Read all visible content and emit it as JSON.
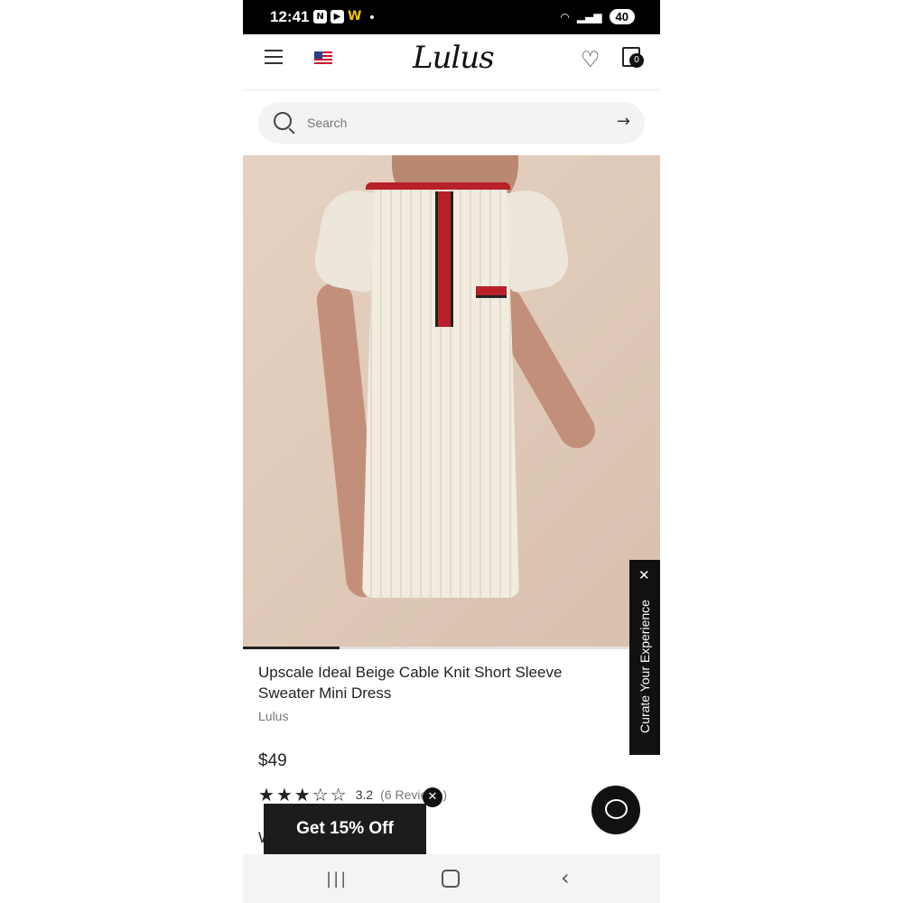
{
  "status_bar": {
    "time": "12:41",
    "battery": "40"
  },
  "header": {
    "logo_text": "Lulus",
    "cart_count": "0"
  },
  "search": {
    "placeholder": "Search"
  },
  "carousel": {
    "progress": 0.25
  },
  "product": {
    "title": "Upscale Ideal Beige Cable Knit Short Sleeve Sweater Mini Dress",
    "brand": "Lulus",
    "price": "$49",
    "rating": 3.2,
    "rating_text": "3.2",
    "reviews_text": "(6 Reviews)",
    "partial_next_text": "W"
  },
  "side_tab": {
    "label": "Curate Your Experience"
  },
  "promo": {
    "label": "Get 15% Off"
  },
  "colors": {
    "accent_red": "#b8202a",
    "dark": "#111111"
  }
}
